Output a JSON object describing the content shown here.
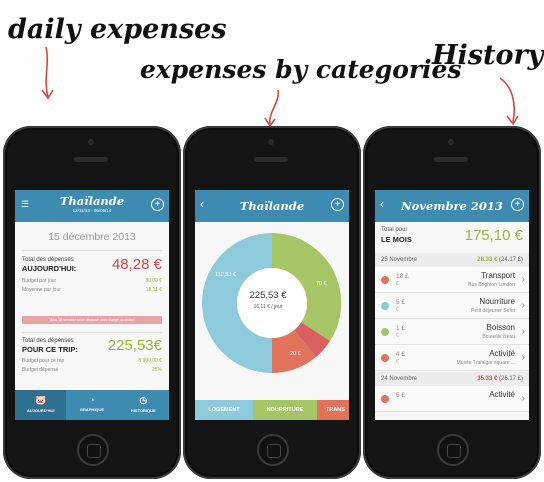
{
  "annotations": {
    "daily": "daily expenses",
    "categories": "expenses by categories",
    "history": "History"
  },
  "colors": {
    "bar": "#3d8bb0",
    "red": "#c94a4a",
    "green": "#9bb335",
    "teal": "#8dcadb",
    "food": "#a5c665",
    "transport": "#e0735a"
  },
  "screen1": {
    "title": "Thaïlande",
    "subtitle": "12/11/13 - 05/05/14",
    "date": "15 décembre 2013",
    "today_label": "Total des dépenses",
    "today_label_big": "AUJOURD'HUI:",
    "today_amount": "48,28 €",
    "budget_day_label": "Budget par jour",
    "budget_day_value": "30,00 €",
    "avg_day_label": "Moyenne par jour",
    "avg_day_value": "18,11 €",
    "alert": "Vous 18 semblez avoir dépassé votre budget quotidien",
    "trip_label": "Total des dépenses",
    "trip_label_big": "POUR CE TRIP:",
    "trip_amount": "225,53€",
    "budget_trip_label": "Budget pour ce trip",
    "budget_trip_value": "8 900,00 €",
    "spent_label": "Budget dépensé",
    "spent_value": "25%",
    "tabs": [
      "AUJOURD'HUI",
      "GRAPHIQUE",
      "HISTORIQUE"
    ]
  },
  "screen2": {
    "title": "Thaïlande",
    "center_amount": "225,53 €",
    "center_daily": "16,11 € / jour",
    "slices": {
      "teal": "112,53 €",
      "green": "70 €",
      "orange": "20 €"
    },
    "categories": [
      "LOGEMENT",
      "NOURRITURE",
      "TRANS"
    ]
  },
  "screen3": {
    "title": "Novembre 2013",
    "total_label": "Total pour",
    "total_label_big": "LE MOIS",
    "total_amount": "175,10 €",
    "days": [
      {
        "date": "25 Novembre",
        "value": "28.33 €",
        "value_paren": "(24.17 £)"
      },
      {
        "date": "24 Novembre",
        "value": "35.33 €",
        "value_paren": "(26.17 £)"
      }
    ],
    "rows": [
      {
        "amount": "18 £",
        "currency": "€",
        "category": "Transport",
        "desc": "Bus Brighton London"
      },
      {
        "amount": "5 £",
        "currency": "€",
        "category": "Nourriture",
        "desc": "Petit déjeuner Soho"
      },
      {
        "amount": "1 £",
        "currency": "€",
        "category": "Boisson",
        "desc": "Bouteille d'eau"
      },
      {
        "amount": "4 £",
        "currency": "€",
        "category": "Activité",
        "desc": "Musée Trafalgar square ..."
      },
      {
        "amount": "5 £",
        "currency": "",
        "category": "Activité",
        "desc": ""
      }
    ]
  }
}
